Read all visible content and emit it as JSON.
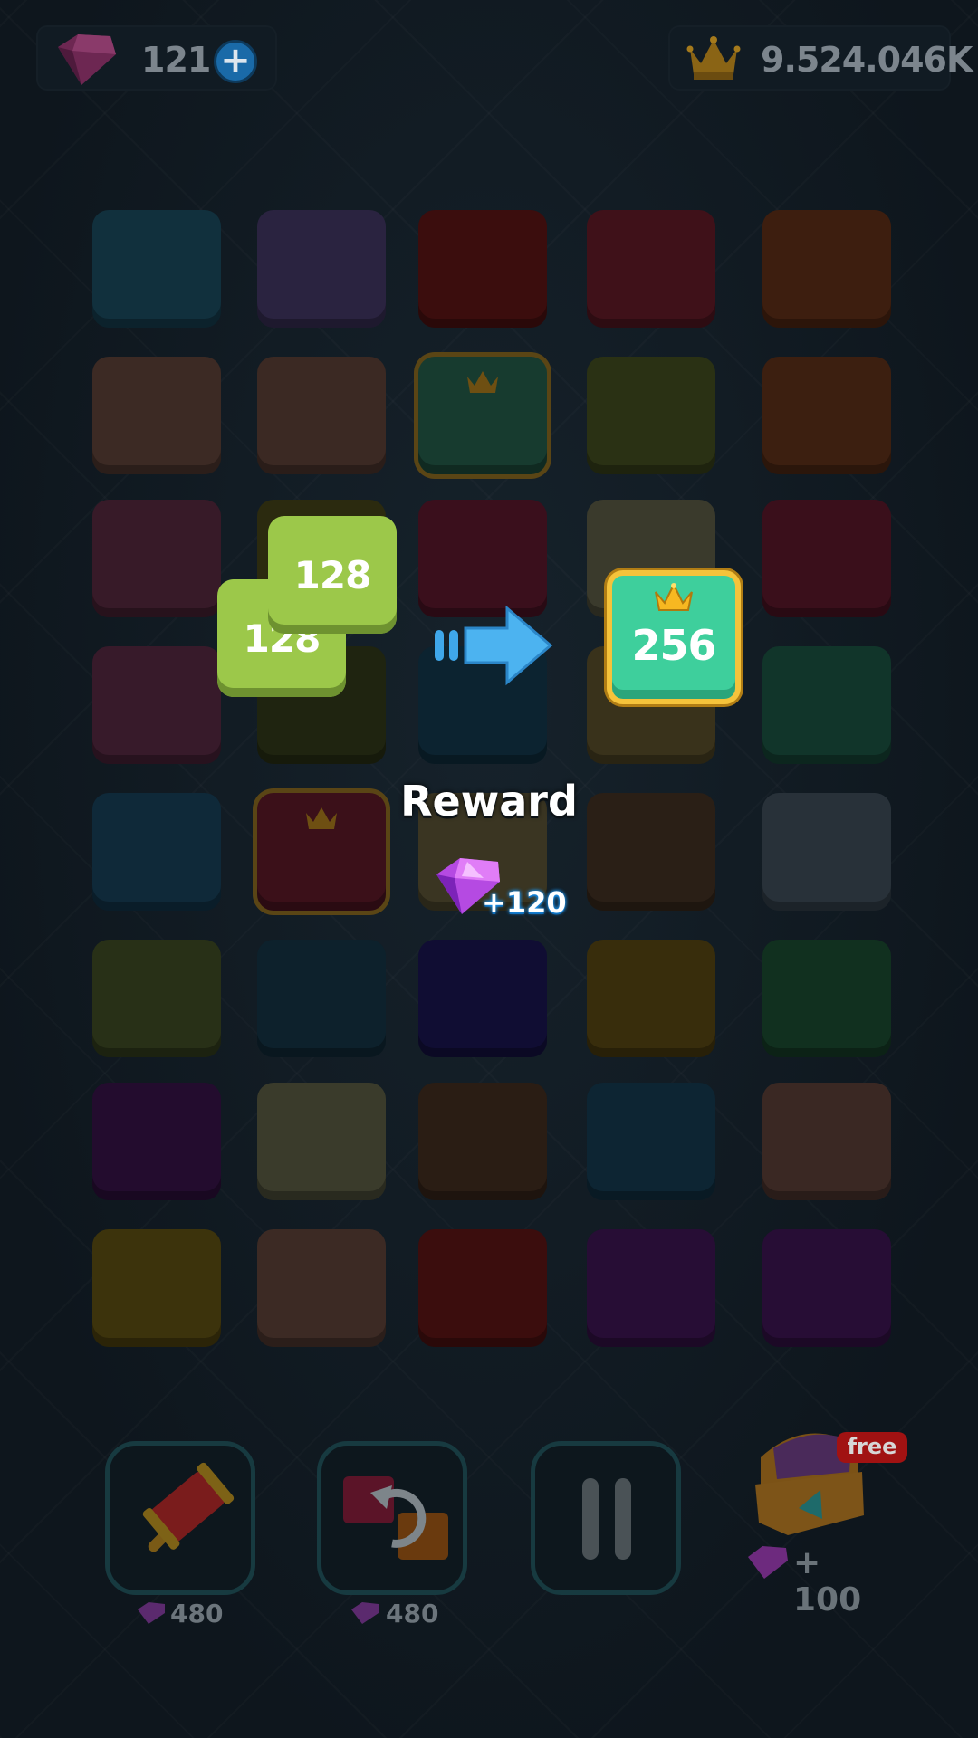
{
  "top_bar": {
    "gems_count": "121",
    "plus_label": "+",
    "score": "9.524.046K"
  },
  "board": {
    "rows": [
      [
        "#11303d",
        "#2a2340",
        "#3b0d0d",
        "#3f1119",
        "#3d1e0f"
      ],
      [
        "#3c2a24",
        "#3b2923",
        "#173b2f",
        "#2a3114",
        "#3c1f10"
      ],
      [
        "#371a28",
        "#2b2a0f",
        "#3a0f1c",
        "#3a3a2c",
        "#3a0f1b"
      ],
      [
        "#371a2a",
        "#1f2410",
        "#0c2330",
        "#39321b",
        "#11352a"
      ],
      [
        "#0f2939",
        "#3b1019",
        "#3a3522",
        "#2a1f16",
        "#283139"
      ],
      [
        "#283017",
        "#0d212c",
        "#100d33",
        "#382d0c",
        "#11301f"
      ],
      [
        "#230c2e",
        "#3a3b2b",
        "#2a1d14",
        "#0d2533",
        "#3a2823"
      ],
      [
        "#3c330c",
        "#3c2a24",
        "#3b0d0d",
        "#270d35",
        "#270d35"
      ]
    ],
    "crowned_cells": [
      "r1c2",
      "r4c1"
    ]
  },
  "merge_demo": {
    "tile_back": "128",
    "tile_front": "128",
    "result": "256"
  },
  "reward": {
    "title": "Reward",
    "amount": "+120"
  },
  "tools": {
    "hammer_cost": "480",
    "swap_cost": "480",
    "chest_badge": "free",
    "chest_cost": "+ 100"
  }
}
